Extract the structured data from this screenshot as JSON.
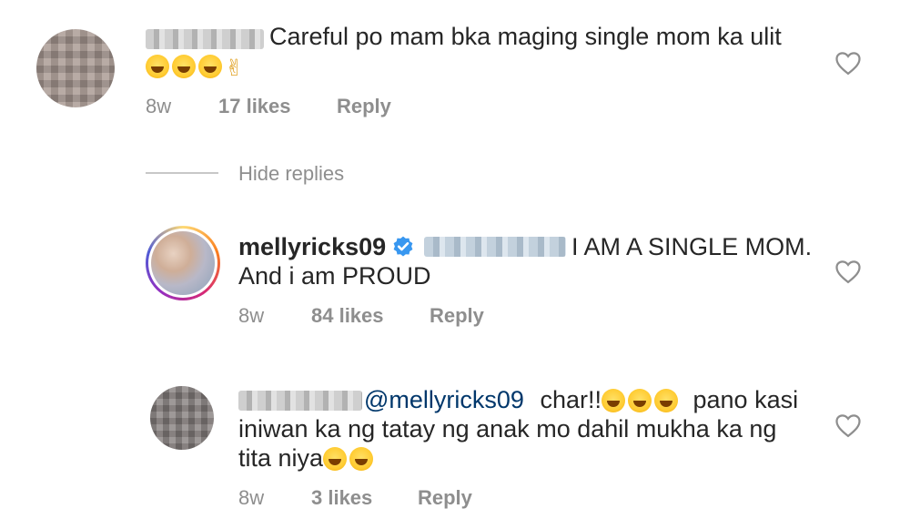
{
  "comments": [
    {
      "text_line1": "Careful po mam bka maging single mom ka ulit",
      "emojis_line2": [
        "laughing-tears",
        "laughing-tears",
        "laughing-tears",
        "victory-hand"
      ],
      "time": "8w",
      "likes": "17 likes",
      "reply": "Reply"
    }
  ],
  "hide_replies": "Hide replies",
  "replies": [
    {
      "username": "mellyricks09",
      "text_line1": "I AM A SINGLE MOM.",
      "text_line2": "And i am PROUD",
      "time": "8w",
      "likes": "84 likes",
      "reply": "Reply"
    },
    {
      "mention": "@mellyricks09",
      "text_line1_after": "char!!",
      "text_line1_tail": "pano kasi",
      "text_line2": "iniwan ka ng tatay ng anak mo dahil mukha ka ng",
      "text_line3": "tita niya",
      "time": "8w",
      "likes": "3 likes",
      "reply": "Reply"
    }
  ],
  "colors": {
    "text": "#262626",
    "meta": "#8e8e8e",
    "mention": "#00376b",
    "verified": "#3897f0"
  }
}
